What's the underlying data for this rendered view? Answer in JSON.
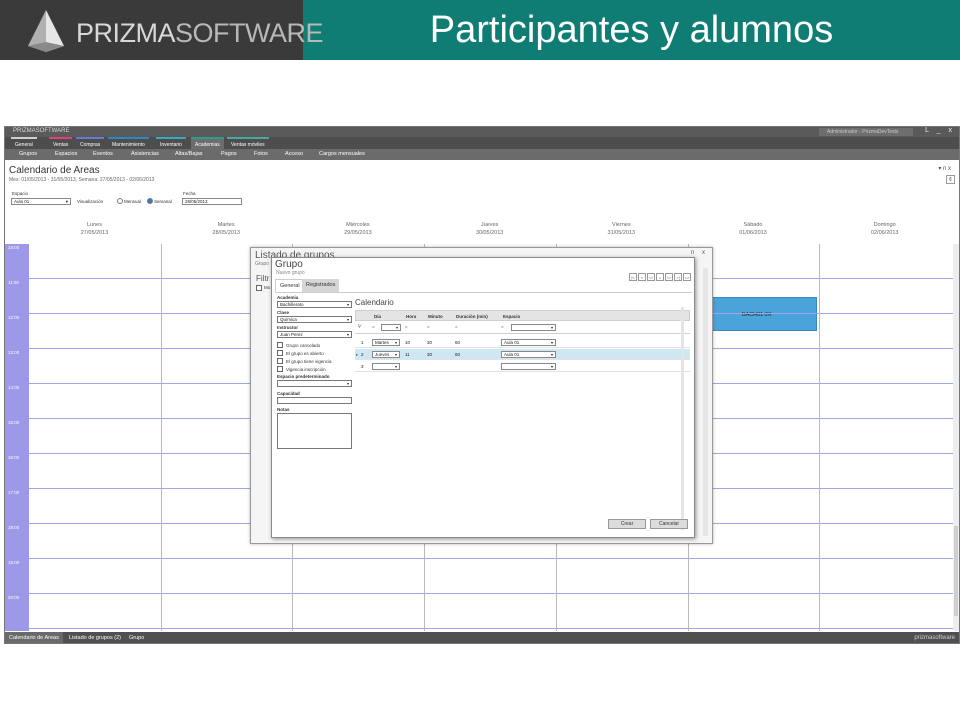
{
  "slide": {
    "logo_text_bold": "PRIZMA",
    "logo_text_light": "SOFTWARE",
    "title": "Participantes y alumnos"
  },
  "app": {
    "brand": "PRIZMASOFTWARE",
    "user": "Administrador - PrizmaDevTests",
    "window_controls": "L _ x",
    "main_tabs": [
      {
        "label": "General",
        "color": "#d0cfcf"
      },
      {
        "label": "Ventas",
        "color": "#e0407a"
      },
      {
        "label": "Compras",
        "color": "#6b78d0"
      },
      {
        "label": "Mantenimiento",
        "color": "#2f86c7"
      },
      {
        "label": "Inventario",
        "color": "#3aa8c1"
      },
      {
        "label": "Academias",
        "color": "#2e9c8c"
      },
      {
        "label": "Ventas móviles",
        "color": "#47a8a0"
      }
    ],
    "sub_nav": [
      "Grupos",
      "Espacios",
      "Eventos",
      "Asistencias",
      "Altas/Bajas",
      "Pagos",
      "Fotos",
      "Acceso",
      "Cargos mensuales"
    ],
    "calendar": {
      "title": "Calendario de Areas",
      "subtitle": "Mes: 01/05/2013 - 31/05/2013, Semana: 27/05/2013 - 02/06/2013",
      "doc_controls": "▾ n x",
      "doc_button": "¢",
      "espacio_label": "Espacio",
      "espacio_value": "Aula 01",
      "visualizacion_label": "Visualización",
      "mensual_label": "Mensual",
      "semanal_label": "Semanal",
      "fecha_label": "Fecha",
      "fecha_value": "28/05/2013",
      "days": [
        {
          "name": "Lunes",
          "date": "27/05/2013"
        },
        {
          "name": "Martes",
          "date": "28/05/2013"
        },
        {
          "name": "Miércoles",
          "date": "29/05/2013"
        },
        {
          "name": "Jueves",
          "date": "30/05/2013"
        },
        {
          "name": "Viernes",
          "date": "31/05/2013"
        },
        {
          "name": "Sábado",
          "date": "01/06/2013"
        },
        {
          "name": "Domingo",
          "date": "02/06/2013"
        }
      ],
      "hours": [
        "10:00",
        "11:00",
        "12:00",
        "13:00",
        "14:00",
        "15:00",
        "16:00",
        "17:00",
        "18:00",
        "19:00",
        "20:00"
      ],
      "event": {
        "label": "BACH01-26",
        "color": "#4aa3d9"
      }
    },
    "status_tabs": [
      "Calendario de Areas",
      "Listado de grupos (2)",
      "Grupo"
    ],
    "status_brand": "prizmasoftware"
  },
  "listado": {
    "title": "Listado de grupos",
    "subtitle": "Grupo",
    "filtro_label": "Filtr",
    "check_label": "Mo",
    "controls": "n x"
  },
  "grupo": {
    "title": "Grupo",
    "subtitle": "Nuevo grupo",
    "nav_controls": [
      "|<",
      "<",
      "<<",
      ">",
      ">>",
      ">|",
      "<>"
    ],
    "tabs": [
      "General",
      "Registrados"
    ],
    "academia_label": "Academia",
    "academia_value": "Bachillerato",
    "clase_label": "Clase",
    "clase_value": "Química",
    "instructor_label": "Instructor",
    "instructor_value": "Juan Perez",
    "checks": [
      "Grupo cancelado",
      "El grupo es abierto",
      "El grupo tiene vigencia",
      "Vigencia inscripción"
    ],
    "espacio_pred_label": "Espacio predeterminado",
    "espacio_pred_value": "",
    "capacidad_label": "Capacidad",
    "capacidad_value": "",
    "notas_label": "Notas",
    "calendario_title": "Calendario",
    "table_headers": [
      "Día",
      "Hora",
      "Minuto",
      "Duración (min)",
      "Espacio"
    ],
    "filter_symbol": "=",
    "rows": [
      {
        "num": "1",
        "dia": "Martes",
        "hora": "10",
        "minuto": "30",
        "duracion": "60",
        "espacio": "Aula 01",
        "selected": false
      },
      {
        "num": "2",
        "dia": "Jueves",
        "hora": "11",
        "minuto": "30",
        "duracion": "60",
        "espacio": "Aula 01",
        "selected": true
      },
      {
        "num": "3",
        "dia": "",
        "hora": "",
        "minuto": "",
        "duracion": "",
        "espacio": "",
        "selected": false
      }
    ],
    "crear_label": "Crear",
    "cancelar_label": "Cancelar"
  }
}
